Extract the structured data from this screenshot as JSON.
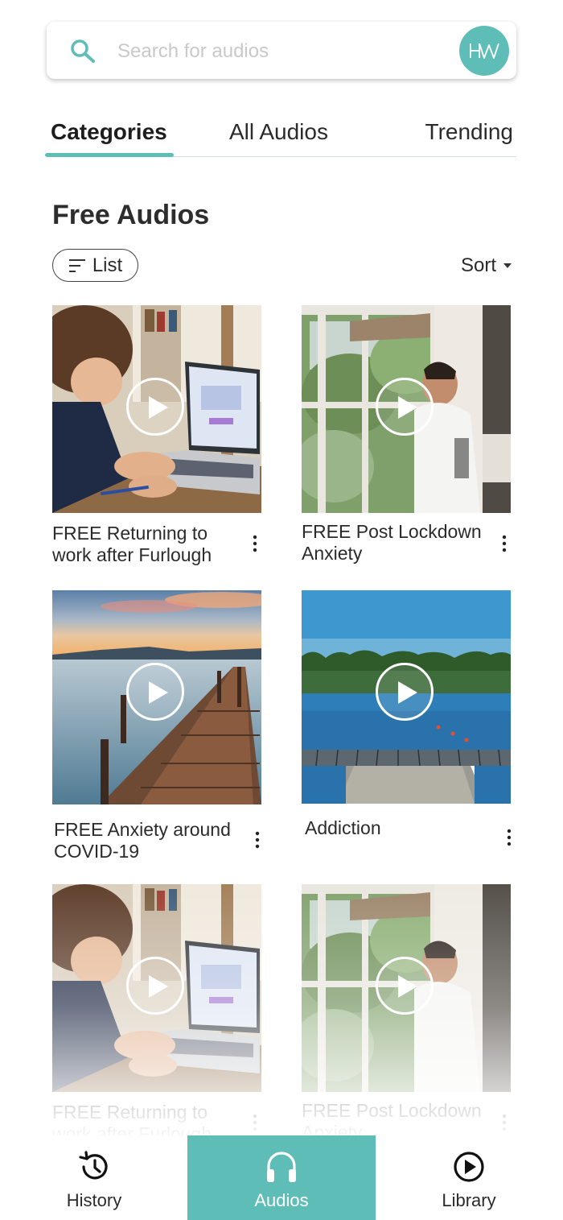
{
  "search": {
    "placeholder": "Search for audios",
    "avatar_logo_text": "HW"
  },
  "tabs": [
    {
      "label": "Categories",
      "active": true
    },
    {
      "label": "All Audios",
      "active": false
    },
    {
      "label": "Trending",
      "active": false
    }
  ],
  "section": {
    "title": "Free Audios"
  },
  "controls": {
    "list_label": "List",
    "sort_label": "Sort"
  },
  "audios": [
    {
      "title": "FREE Returning to work after Furlough",
      "image": "woman-laptop"
    },
    {
      "title": "FREE Post Lockdown Anxiety",
      "image": "man-window"
    },
    {
      "title": "FREE Anxiety around COVID-19",
      "image": "sunset-pier"
    },
    {
      "title": "Addiction",
      "image": "lake-dock"
    },
    {
      "title": "FREE Returning to work after Furlough",
      "image": "woman-laptop"
    },
    {
      "title": "FREE Post Lockdown Anxiety",
      "image": "man-window"
    }
  ],
  "bottom_nav": [
    {
      "label": "History",
      "icon": "history-icon",
      "active": false
    },
    {
      "label": "Audios",
      "icon": "headphones-icon",
      "active": true
    },
    {
      "label": "Library",
      "icon": "play-circle-icon",
      "active": false
    }
  ],
  "colors": {
    "accent": "#5fbdb8",
    "text": "#2b2b2b",
    "placeholder": "#c9c9c9"
  }
}
